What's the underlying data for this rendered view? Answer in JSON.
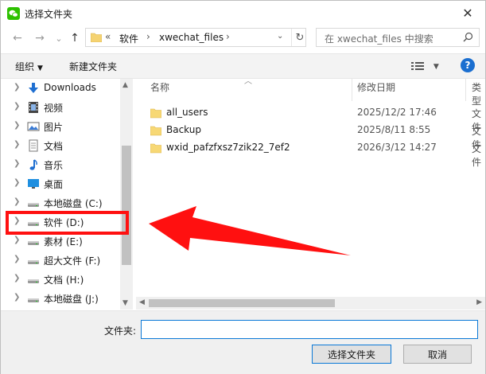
{
  "window": {
    "title": "选择文件夹",
    "close": "✕"
  },
  "nav": {
    "back": "←",
    "forward": "→",
    "recent": "⌄",
    "up": "↑"
  },
  "address": {
    "overflow": "«",
    "crumbs": [
      "软件",
      "xwechat_files"
    ],
    "sep": "›",
    "dropdown": "⌄",
    "refresh": "↻"
  },
  "search": {
    "placeholder": "在 xwechat_files 中搜索"
  },
  "toolbar": {
    "organize": "组织",
    "organize_caret": "▼",
    "new_folder": "新建文件夹",
    "view_caret": "▼",
    "help": "?"
  },
  "tree": {
    "items": [
      {
        "label": "Downloads",
        "icon": "download-icon"
      },
      {
        "label": "视频",
        "icon": "video-icon"
      },
      {
        "label": "图片",
        "icon": "picture-icon"
      },
      {
        "label": "文档",
        "icon": "document-icon"
      },
      {
        "label": "音乐",
        "icon": "music-icon"
      },
      {
        "label": "桌面",
        "icon": "desktop-icon"
      },
      {
        "label": "本地磁盘 (C:)",
        "icon": "drive-icon"
      },
      {
        "label": "软件 (D:)",
        "icon": "drive-icon"
      },
      {
        "label": "素材 (E:)",
        "icon": "drive-icon"
      },
      {
        "label": "超大文件 (F:)",
        "icon": "drive-icon"
      },
      {
        "label": "文档 (H:)",
        "icon": "drive-icon"
      },
      {
        "label": "本地磁盘 (J:)",
        "icon": "drive-icon"
      }
    ]
  },
  "columns": {
    "name": "名称",
    "date": "修改日期",
    "type": "类型"
  },
  "files": [
    {
      "name": "all_users",
      "date": "2025/12/2 17:46",
      "type": "文件"
    },
    {
      "name": "Backup",
      "date": "2025/8/11 8:55",
      "type": "文件"
    },
    {
      "name": "wxid_pafzfxsz7zik22_7ef2",
      "date": "2026/3/12 14:27",
      "type": "文件"
    }
  ],
  "footer": {
    "folder_label": "文件夹:",
    "folder_value": "",
    "select_button": "选择文件夹",
    "cancel_button": "取消"
  },
  "colors": {
    "highlight": "#ff1010",
    "arrow": "#ff1010",
    "accent": "#0a78d7",
    "wechat": "#2dc100"
  }
}
